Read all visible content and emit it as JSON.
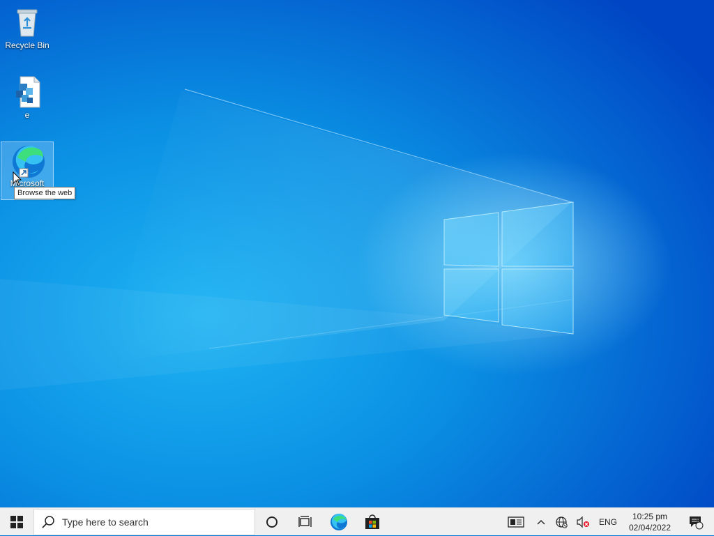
{
  "desktop": {
    "icons": [
      {
        "label": "Recycle Bin",
        "icon": "recycle-bin-icon"
      },
      {
        "label": "e",
        "icon": "file-icon"
      },
      {
        "label": "Microsoft",
        "icon": "edge-icon"
      }
    ],
    "tooltip": "Browse the web"
  },
  "taskbar": {
    "search_placeholder": "Type here to search",
    "apps": [
      "cortana-icon",
      "task-view-icon",
      "edge-icon",
      "store-icon"
    ],
    "tray": {
      "language": "ENG",
      "time": "10:25 pm",
      "date": "02/04/2022",
      "notification_count": "1"
    }
  },
  "colors": {
    "wallpaper_base": "#0078d7",
    "wallpaper_light": "#33b8f6",
    "taskbar": "#f0f0f0"
  }
}
